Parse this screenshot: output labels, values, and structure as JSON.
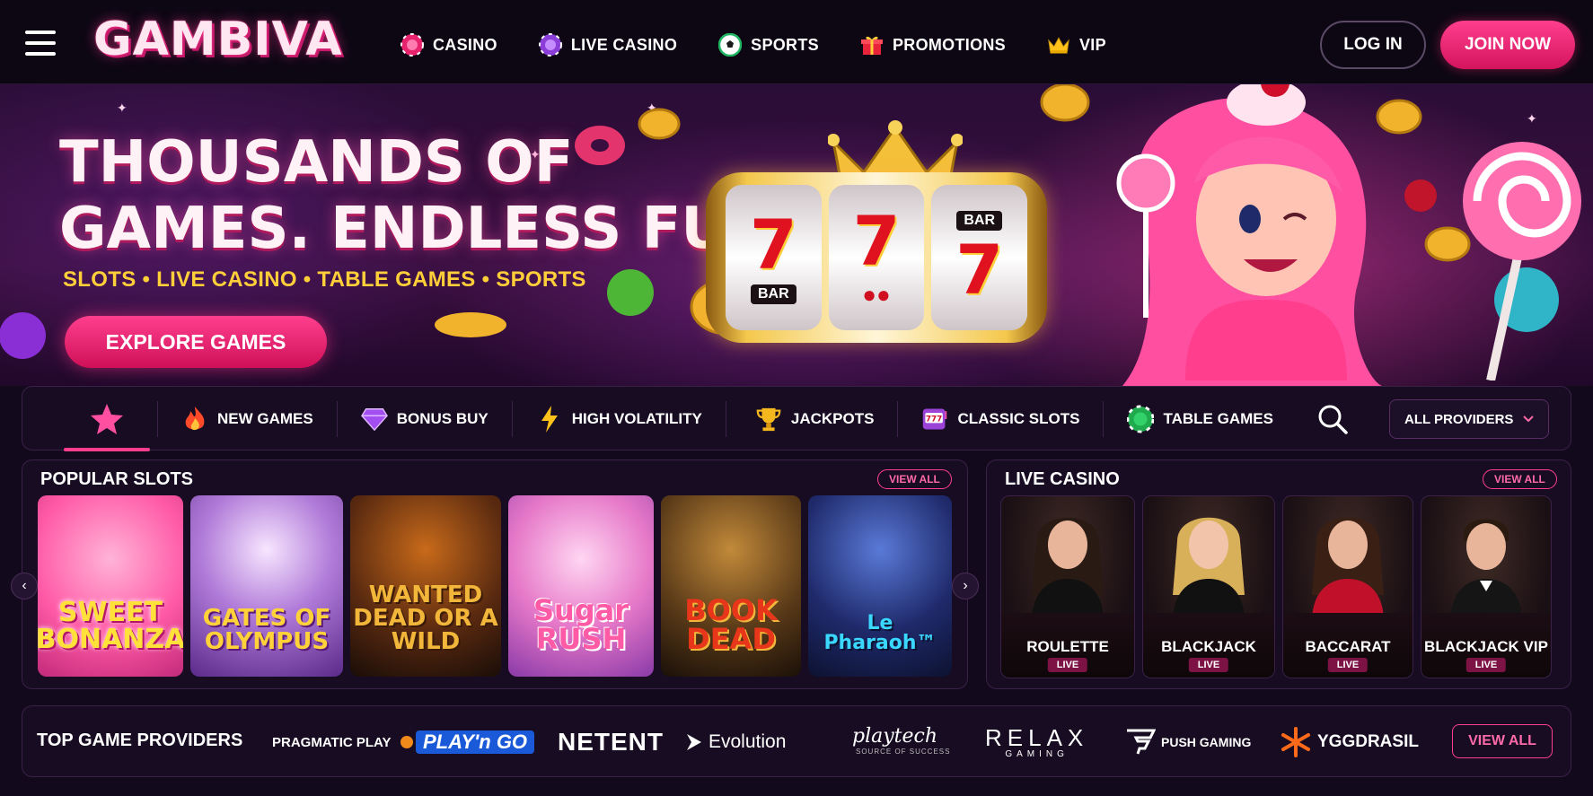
{
  "brand": {
    "logo_text": "GAMBIVA"
  },
  "nav": {
    "items": [
      {
        "label": "CASINO",
        "icon": "casino-chip-icon"
      },
      {
        "label": "LIVE CASINO",
        "icon": "live-chip-icon"
      },
      {
        "label": "SPORTS",
        "icon": "soccer-ball-icon"
      },
      {
        "label": "PROMOTIONS",
        "icon": "gift-icon"
      },
      {
        "label": "VIP",
        "icon": "crown-icon"
      }
    ],
    "login_label": "LOG IN",
    "join_label": "JOIN NOW"
  },
  "hero": {
    "title": "THOUSANDS OF\nGAMES. ENDLESS FUN!",
    "subtitle": "SLOTS • LIVE CASINO • TABLE GAMES • SPORTS",
    "cta_label": "EXPLORE GAMES",
    "reel_bar_label": "BAR",
    "reel_seven": "7"
  },
  "filters": {
    "favorite_icon": "star-icon",
    "tabs": [
      {
        "label": "NEW GAMES",
        "icon": "fire-icon"
      },
      {
        "label": "BONUS BUY",
        "icon": "diamond-icon"
      },
      {
        "label": "HIGH VOLATILITY",
        "icon": "lightning-icon"
      },
      {
        "label": "JACKPOTS",
        "icon": "trophy-icon"
      },
      {
        "label": "CLASSIC SLOTS",
        "icon": "slot-machine-icon"
      },
      {
        "label": "TABLE GAMES",
        "icon": "poker-chip-icon"
      }
    ],
    "providers_select": "ALL PROVIDERS"
  },
  "popular_slots": {
    "title": "POPULAR SLOTS",
    "view_all": "VIEW ALL",
    "games": [
      {
        "name": "SWEET\nBONANZA"
      },
      {
        "name": "GATES OF\nOLYMPUS"
      },
      {
        "name": "WANTED\nDEAD OR A WILD"
      },
      {
        "name": "Sugar\nRUSH"
      },
      {
        "name": "BOOK\nDEAD"
      },
      {
        "name": "Le Pharaoh™"
      }
    ]
  },
  "live_casino": {
    "title": "LIVE CASINO",
    "view_all": "VIEW ALL",
    "badge": "LIVE",
    "games": [
      {
        "name": "ROULETTE"
      },
      {
        "name": "BLACKJACK"
      },
      {
        "name": "BACCARAT"
      },
      {
        "name": "BLACKJACK VIP"
      }
    ]
  },
  "providers": {
    "title": "TOP GAME PROVIDERS",
    "items": [
      {
        "name": "PRAGMATIC PLAY"
      },
      {
        "name": "PLAY'n GO"
      },
      {
        "name": "NETENT"
      },
      {
        "name": "Evolution"
      },
      {
        "name": "playtech"
      },
      {
        "name": "SOURCE OF SUCCESS"
      },
      {
        "name": "RELAX"
      },
      {
        "name": "GAMING"
      },
      {
        "name": "PUSH GAMING"
      },
      {
        "name": "YGGDRASIL"
      }
    ],
    "view_all": "VIEW ALL"
  },
  "colors": {
    "accent_pink": "#ff3f8e",
    "gold": "#ffcf3a",
    "panel": "#170c22",
    "background": "#120a1c"
  }
}
